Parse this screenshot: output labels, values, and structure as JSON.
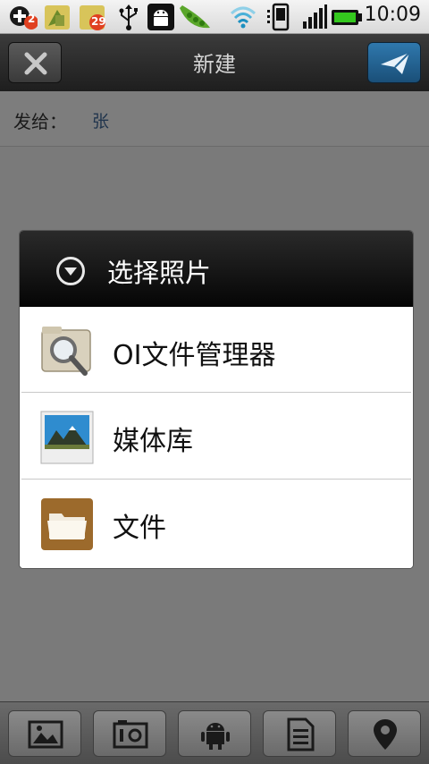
{
  "status_bar": {
    "time": "10:09",
    "icons": [
      "add-notification-icon",
      "app-update-icon",
      "app-update-icon",
      "usb-icon",
      "android-debug-icon",
      "pea-pod-icon",
      "wifi-icon",
      "phone-sync-icon",
      "signal-icon",
      "battery-icon"
    ],
    "badges": {
      "first": "2",
      "third": "29"
    }
  },
  "title_bar": {
    "title": "新建",
    "close_icon": "close-icon",
    "send_icon": "send-icon",
    "send_color": "#2a6a9a"
  },
  "recipient": {
    "label": "发给：",
    "value": "张"
  },
  "dialog": {
    "title": "选择照片",
    "header_icon": "chevron-down-circle-icon",
    "items": [
      {
        "label": "OI文件管理器",
        "icon": "file-manager-magnifier-icon"
      },
      {
        "label": "媒体库",
        "icon": "gallery-landscape-icon"
      },
      {
        "label": "文件",
        "icon": "folder-icon"
      }
    ]
  },
  "bottom_bar": {
    "buttons": [
      "image-icon",
      "camera-icon",
      "android-icon",
      "document-icon",
      "location-pin-icon"
    ]
  }
}
